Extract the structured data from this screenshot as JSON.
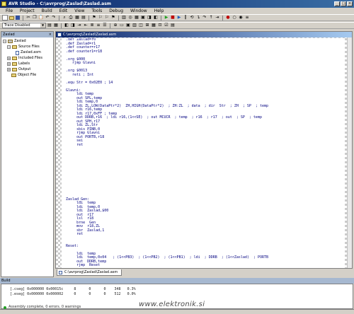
{
  "window": {
    "title": "AVR Studio - C:\\avrprog\\Zaslad\\Zaslad.asm",
    "buttons": [
      "_",
      "□",
      "×"
    ]
  },
  "menu": [
    "File",
    "Project",
    "Build",
    "Edit",
    "View",
    "Tools",
    "Debug",
    "Window",
    "Help"
  ],
  "toolbar": {
    "trace_combo": "Trace Disabled"
  },
  "project_panel": {
    "header": "Zaslad",
    "items": [
      {
        "label": "Zaslad",
        "type": "root"
      },
      {
        "label": "Source Files",
        "type": "folder"
      },
      {
        "label": "Zaslad.asm",
        "type": "file"
      },
      {
        "label": "Included Files",
        "type": "folder"
      },
      {
        "label": "Labels",
        "type": "folder"
      },
      {
        "label": "Output",
        "type": "folder"
      },
      {
        "label": "Object File",
        "type": "folder"
      }
    ]
  },
  "editor": {
    "title": "C:\\avrprog\\Zaslad\\Zaslad.asm",
    "tab": "C:\\avrprog\\Zaslad\\Zaslad.asm",
    "lines": [
      "  .def Zaslad=r0",
      "  .def Zaslad=r1",
      "  .def counter=r17",
      "  .def counter1=r18",
      "",
      "  .org $000",
      "     rjmp Glavni",
      "",
      "  .org $0013",
      "     reti ; Int",
      "",
      "  .equ Str = 0x02E0 ; 14",
      "",
      "  Glavni:",
      "       ldi temp",
      "       out SPL,temp",
      "       ldi temp,0",
      "       ldi ZL,LOW(DataPtr*2)  ZH,HIGH(DataPtr*2)  ; ZH:ZL  ; data  ; dir  Str  ; ZH  ; SP  ; temp",
      "       ldi r16,temp",
      "       ldi r17,0xFF ; temp",
      "       out DDRB,r16  ; ldi r16,(1<<SE)  ; out MCUCR  ; temp  ; r16  ; r17  ; out  ; SP  ; temp",
      "       out SPH,r17",
      "       ldi ZL,Str",
      "       sbis PINB,0",
      "       rjmp Glavni",
      "       out PORTB,r18",
      "       sei",
      "       ret",
      "",
      "",
      "",
      "",
      "",
      "",
      "",
      "",
      "",
      "",
      "",
      "",
      "",
      "  Zaslad_Gen:",
      "       ldi  temp",
      "       ldi  temp,0",
      "       ldi  Zaslad,$00",
      "       out  r17",
      "       lsl  r18",
      "       brne  Gen",
      "       mov  r18,ZL",
      "       sbr  Zaslad,1",
      "       ret",
      "",
      "",
      "  Reset:",
      "",
      "       ldi  temp",
      "       ldi  temp,0x04   ; (1<<PB3)  ; (1<<PB2)  ; (1<<PB1)  ; ldi  ; DDRB  ; (1<<Zaslad)  ; PORTB",
      "       out  DDRB,temp",
      "       rjmp  Reset"
    ]
  },
  "output": {
    "header": "Build",
    "rows": [
      "  [.cseg] 0x000000 0x00015c     8      0      0    348   0.3%",
      "  [.eseg] 0x000000 0x000002     0      0      0    512   0.0%"
    ],
    "status": "Assembly complete, 0 errors. 0 warnings"
  },
  "watermark": "www.elektronik.si"
}
